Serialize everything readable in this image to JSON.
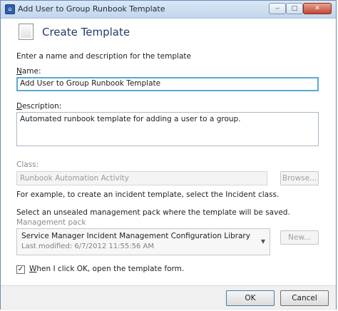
{
  "window": {
    "title": "Add User to Group Runbook Template",
    "minimize_glyph": "‒",
    "maximize_glyph": "□",
    "close_glyph": "✕",
    "app_icon_glyph": "⌂"
  },
  "header": {
    "title": "Create Template",
    "icon": "template-page-icon"
  },
  "intro_text": "Enter a name and description for the template",
  "name": {
    "label_accel": "N",
    "label_rest": "ame:",
    "value": "Add User to Group Runbook Template"
  },
  "description": {
    "label_accel": "D",
    "label_rest": "escription:",
    "value": "Automated runbook template for adding a user to a group."
  },
  "class": {
    "label": "Class:",
    "value": "Runbook Automation Activity",
    "browse_label": "Browse...",
    "hint": "For example, to create an incident template, select the Incident class."
  },
  "management_pack": {
    "instruction": "Select an unsealed management pack where the template will be saved.",
    "label": "Management pack",
    "selected_name": "Service Manager Incident Management Configuration Library",
    "last_modified": "Last modified:  6/7/2012 11:55:56 AM",
    "new_label": "New..."
  },
  "open_form_option": {
    "checked": true,
    "check_glyph": "✓",
    "label_accel": "W",
    "label_rest": "hen I click OK, open the template form."
  },
  "buttons": {
    "ok": "OK",
    "cancel": "Cancel"
  },
  "colors": {
    "title_bar": "#c3d6ec",
    "focus_border": "#5aa8d6",
    "header_title": "#1f3a6e",
    "close_button": "#c24632"
  }
}
